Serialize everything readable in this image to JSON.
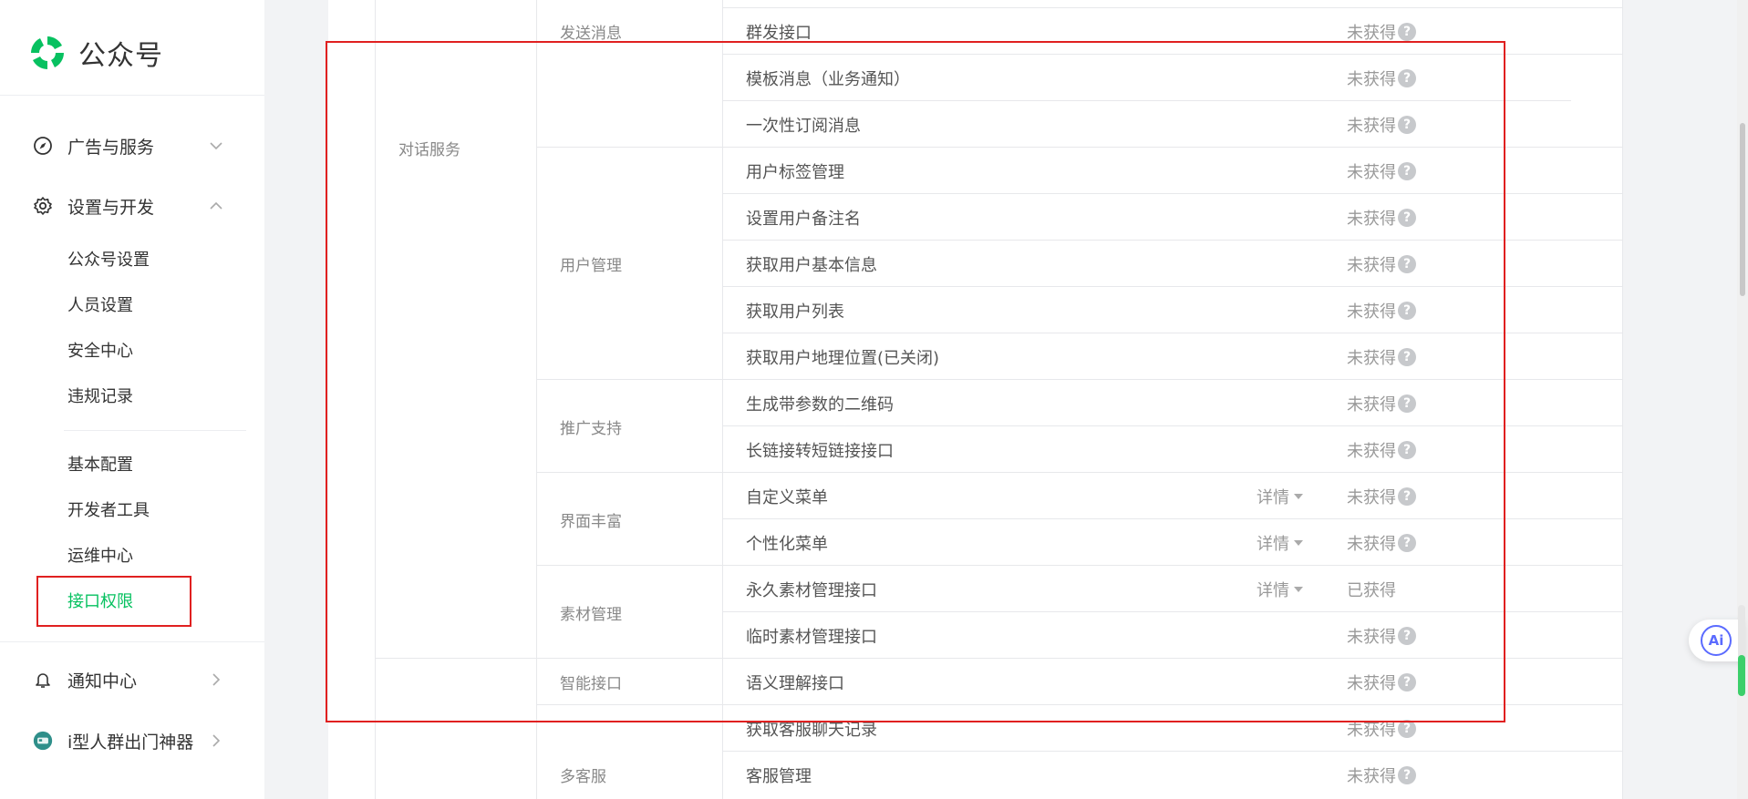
{
  "app": {
    "name": "公众号"
  },
  "sidebar": {
    "groups": [
      {
        "label": "广告与服务"
      },
      {
        "label": "设置与开发"
      },
      {
        "label": "通知中心"
      },
      {
        "label": "i型人群出门神器"
      }
    ],
    "items": [
      {
        "label": "公众号设置"
      },
      {
        "label": "人员设置"
      },
      {
        "label": "安全中心"
      },
      {
        "label": "违规记录"
      },
      {
        "label": "基本配置"
      },
      {
        "label": "开发者工具"
      },
      {
        "label": "运维中心"
      },
      {
        "label": "接口权限"
      }
    ]
  },
  "table": {
    "categories": [
      {
        "label": "对话服务"
      }
    ],
    "subcategories": [
      {
        "label": "发送消息"
      },
      {
        "label": "用户管理"
      },
      {
        "label": "推广支持"
      },
      {
        "label": "界面丰富"
      },
      {
        "label": "素材管理"
      },
      {
        "label": "智能接口"
      },
      {
        "label": "多客服"
      }
    ],
    "rows": [
      {
        "name": "群发接口",
        "detail": "",
        "status": "未获得",
        "help": "?"
      },
      {
        "name": "模板消息（业务通知）",
        "detail": "",
        "status": "未获得",
        "help": "?"
      },
      {
        "name": "一次性订阅消息",
        "detail": "",
        "status": "未获得",
        "help": "?"
      },
      {
        "name": "用户标签管理",
        "detail": "",
        "status": "未获得",
        "help": "?"
      },
      {
        "name": "设置用户备注名",
        "detail": "",
        "status": "未获得",
        "help": "?"
      },
      {
        "name": "获取用户基本信息",
        "detail": "",
        "status": "未获得",
        "help": "?"
      },
      {
        "name": "获取用户列表",
        "detail": "",
        "status": "未获得",
        "help": "?"
      },
      {
        "name": "获取用户地理位置(已关闭)",
        "detail": "",
        "status": "未获得",
        "help": "?"
      },
      {
        "name": "生成带参数的二维码",
        "detail": "",
        "status": "未获得",
        "help": "?"
      },
      {
        "name": "长链接转短链接接口",
        "detail": "",
        "status": "未获得",
        "help": "?"
      },
      {
        "name": "自定义菜单",
        "detail": "详情",
        "status": "未获得",
        "help": "?"
      },
      {
        "name": "个性化菜单",
        "detail": "详情",
        "status": "未获得",
        "help": "?"
      },
      {
        "name": "永久素材管理接口",
        "detail": "详情",
        "status": "已获得",
        "help": ""
      },
      {
        "name": "临时素材管理接口",
        "detail": "",
        "status": "未获得",
        "help": "?"
      },
      {
        "name": "语义理解接口",
        "detail": "",
        "status": "未获得",
        "help": "?"
      },
      {
        "name": "获取客服聊天记录",
        "detail": "",
        "status": "未获得",
        "help": "?"
      },
      {
        "name": "客服管理",
        "detail": "",
        "status": "未获得",
        "help": "?"
      }
    ]
  },
  "ai_assistant": {
    "label": "Ai"
  },
  "colors": {
    "accent": "#07c160",
    "highlight": "#e02020",
    "ai": "#5b6bff"
  }
}
